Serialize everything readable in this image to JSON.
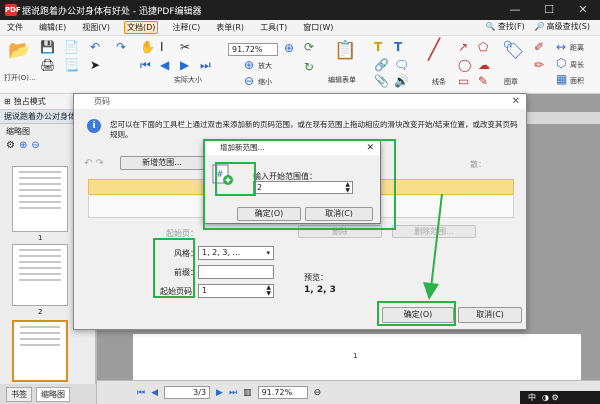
{
  "window": {
    "app_icon": "PDF",
    "title": "据说跑着办公对身体有好处 - 迅捷PDF编辑器",
    "controls": [
      "—",
      "☐",
      "✕"
    ]
  },
  "menu": {
    "items": [
      "文件",
      "编辑(E)",
      "视图(V)",
      "文档(D)",
      "注释(C)",
      "表单(R)",
      "工具(T)",
      "窗口(W)"
    ],
    "active_index": 3,
    "search": "查找(F)",
    "advanced_search": "高级查找(S)"
  },
  "ribbon": {
    "open_label": "打开(O)...",
    "zoom_value": "91.72%",
    "actual_size": "实际大小",
    "zoom_in": "放大",
    "zoom_out": "缩小",
    "edit_form": "编辑表单",
    "lines": "线条",
    "shape": "图章",
    "distance": "距离",
    "perimeter": "周长",
    "area": "面积"
  },
  "leftpanel": {
    "mode": "独占模式",
    "tab": "据说跑着办公对身体有",
    "panel_title": "缩略图",
    "page1": "1",
    "page2": "2",
    "bottom_tab_bookmarks": "书签",
    "bottom_tab_thumbs": "缩略图"
  },
  "doc": {
    "page_number": "1"
  },
  "status": {
    "page_display": "3/3",
    "zoom_display": "91.72%"
  },
  "tray": {
    "ime": "中",
    "extra": "◑ ⚙"
  },
  "dialog": {
    "title": "页码",
    "description": "您可以在下面的工具栏上通过双击来添加新的页码范围，或在现有范围上拖动相应的滑块改变开始/结束位置，或改变其页码规则。",
    "new_range_btn": "新增范围...",
    "delete_btn": "删除",
    "remove_range_btn": "删除范围...",
    "start_page_label": "起始页：",
    "style_label": "风格：",
    "style_value": "1, 2, 3, ...",
    "prefix_label": "前缀：",
    "prefix_value": "",
    "start_number_label": "起始页码：",
    "start_number_value": "1",
    "preview_label": "预览：",
    "preview_value": "1, 2, 3",
    "ok_btn": "确定(O)",
    "cancel_btn": "取消(C)",
    "dirty_label": "散："
  },
  "subdialog": {
    "title": "增加新范围...",
    "input_label": "输入开始范围值：",
    "input_value": "2",
    "ok_btn": "确定(O)",
    "cancel_btn": "取消(C)"
  },
  "colors": {
    "highlight": "#2bb14a",
    "yellow_bar": "#f7dd8c"
  }
}
